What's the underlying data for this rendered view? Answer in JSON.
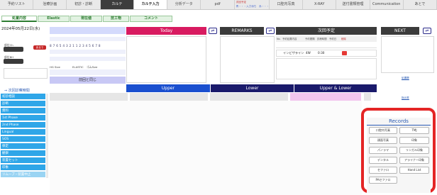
{
  "nav": {
    "tabs": [
      "予約リスト",
      "治療計画",
      "初診・診断",
      "カルテ",
      "カルテ入力",
      "分析データ",
      "pdf",
      "口腔内写真",
      "X-RAY",
      "送付書類管理",
      "Communication",
      "あとで"
    ],
    "memo_line1": "次回予定",
    "memo_line2": "青・・・入力待ち　赤・・・編集中"
  },
  "subtabs": [
    "処置内容",
    "Elastic",
    "現在値",
    "技工物",
    "コメント"
  ],
  "date": "2024年05月22日(水)",
  "left": {
    "label1": "部位Ch",
    "return_btn": "戻るで",
    "label2": "部位BH"
  },
  "number_row": "8 7 6 5 4 3 2 1 1 2 3 4 5 6 7 8",
  "size_row": {
    "hg": "HG Size",
    "elastic": "ELASTIC",
    "elsize": "ゴムSize"
  },
  "same_as_prev": "前回と同じ",
  "today": "Today",
  "remarks": "REMARKS",
  "next_plan": "次回予定",
  "next": "NEXT",
  "plan_table": {
    "headers": [
      "No.",
      "予約処置内容",
      "予約間隔",
      "診療時間",
      "予約日",
      "削除"
    ],
    "row": [
      "",
      "インビザライン",
      "4W",
      "0:30",
      "",
      ""
    ]
  },
  "side_links": {
    "link1": "処置履",
    "link2": "指示書"
  },
  "upper": "Upper",
  "lower": "Lower",
  "upper_lower": "Upper & Lower",
  "sidebar": {
    "title": "⇒ 次回診察時間",
    "items": [
      "初診相談",
      "診断",
      "資料",
      "1st Phase",
      "2nd Phase",
      "Lingual",
      "SOS",
      "保定",
      "観察",
      "装置セット",
      "印象",
      "リムーブ・装置中止"
    ]
  },
  "records": {
    "title": "Records",
    "buttons": [
      "口腔内写真",
      "TMJ",
      "顔面写真",
      "印象",
      "パノラマ",
      "リンガル印象",
      "デンタル",
      "アライナー印象",
      "セファロ",
      "Hand List",
      "PAセファロ"
    ]
  },
  "colors": {
    "today": "#d81b60",
    "remarks": "#3b3b3b",
    "next_plan": "#3b3b3b",
    "next": "#3b3b3b",
    "upper": "#1a4fcf",
    "lower": "#1a1a6b",
    "upper_lower": "#1a1a6b",
    "sidebar_blue": "#2fa6e8",
    "records_border": "#e42525"
  }
}
